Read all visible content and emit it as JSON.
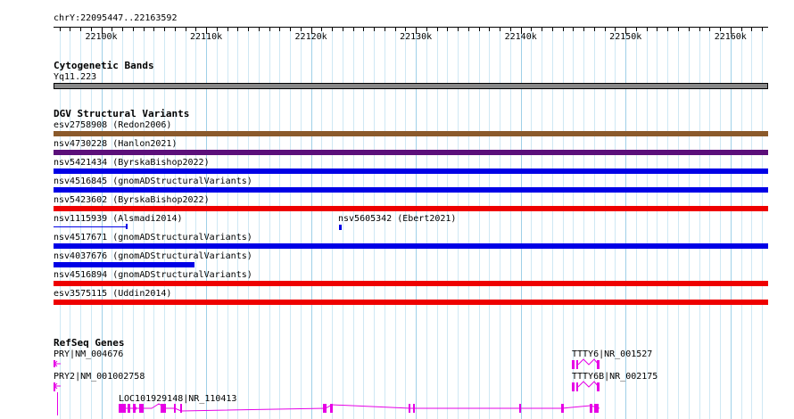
{
  "ruler": {
    "label": "chrY:22095447..22163592",
    "start": 22095447,
    "end": 22163592,
    "ticks": [
      {
        "pos": 22100000,
        "label": "22100k"
      },
      {
        "pos": 22110000,
        "label": "22110k"
      },
      {
        "pos": 22120000,
        "label": "22120k"
      },
      {
        "pos": 22130000,
        "label": "22130k"
      },
      {
        "pos": 22140000,
        "label": "22140k"
      },
      {
        "pos": 22150000,
        "label": "22150k"
      },
      {
        "pos": 22160000,
        "label": "22160k"
      }
    ]
  },
  "cytobands": {
    "title": "Cytogenetic Bands",
    "band": "Yq11.223",
    "color": "#888888"
  },
  "dgv": {
    "title": "DGV Structural Variants",
    "features": [
      {
        "label": "esv2758908 (Redon2006)",
        "color": "#8b5a2b",
        "start": 22095447,
        "end": 22163592
      },
      {
        "label": "nsv4730228 (Hanlon2021)",
        "color": "#5b0f7a",
        "start": 22095447,
        "end": 22163592
      },
      {
        "label": "nsv5421434 (ByrskaBishop2022)",
        "color": "#0000e6",
        "start": 22095447,
        "end": 22163592
      },
      {
        "label": "nsv4516845 (gnomADStructuralVariants)",
        "color": "#0000e6",
        "start": 22095447,
        "end": 22163592
      },
      {
        "label": "nsv5423602 (ByrskaBishop2022)",
        "color": "#ee0000",
        "start": 22095447,
        "end": 22163592
      },
      {
        "label": "nsv1115939 (Alsmadi2014)",
        "color": "#0000e6",
        "start": 22095447,
        "end": 22102400,
        "thin": true
      },
      {
        "label": "nsv5605342 (Ebert2021)",
        "color": "#0000e6",
        "start": 22122700,
        "end": 22122900,
        "tiny": true
      },
      {
        "label": "nsv4517671 (gnomADStructuralVariants)",
        "color": "#0000e6",
        "start": 22095447,
        "end": 22163592
      },
      {
        "label": "nsv4037676 (gnomADStructuralVariants)",
        "color": "#0000e6",
        "start": 22095447,
        "end": 22108900
      },
      {
        "label": "nsv4516894 (gnomADStructuralVariants)",
        "color": "#ee0000",
        "start": 22095447,
        "end": 22163592
      },
      {
        "label": "esv3575115 (Uddin2014)",
        "color": "#ee0000",
        "start": 22095447,
        "end": 22163592
      }
    ]
  },
  "refseq": {
    "title": "RefSeq Genes",
    "color": "#e600e6",
    "genes": [
      {
        "label": "PRY|NM_004676"
      },
      {
        "label": "PRY2|NM_001002758"
      },
      {
        "label": "LOC101929148|NR_110413"
      },
      {
        "label": "TTTY6|NR_001527"
      },
      {
        "label": "TTTY6B|NR_002175"
      }
    ]
  }
}
